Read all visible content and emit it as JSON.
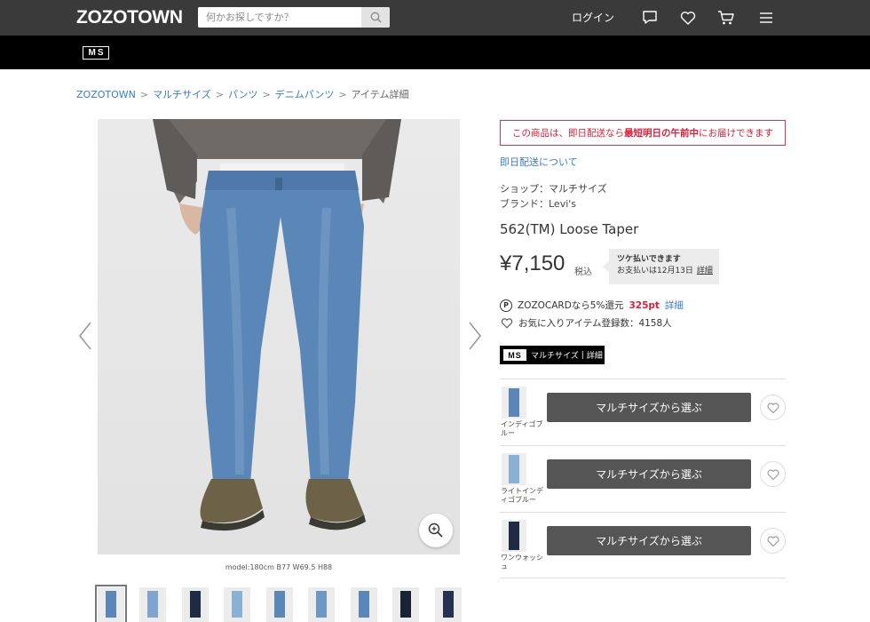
{
  "header": {
    "logo": "ZOZOTOWN",
    "search_placeholder": "何かお探しですか？",
    "login_label": "ログイン",
    "icons": [
      "search-icon",
      "chat-icon",
      "heart-icon",
      "cart-icon",
      "menu-icon"
    ],
    "bg_color": "#3a3a3a"
  },
  "subheader": {
    "shop_logo": "MS",
    "bg_color": "#000000"
  },
  "breadcrumb": {
    "items": [
      "ZOZOTOWN",
      "マルチサイズ",
      "パンツ",
      "デニムパンツ"
    ],
    "current": "アイテム詳細",
    "separator": ">"
  },
  "gallery": {
    "model_info": "model:180cm B77 W69.5 H88",
    "thumbnail_count": 9,
    "selected_thumbnail": 0,
    "icons": [
      "chevron-left-icon",
      "chevron-right-icon",
      "zoom-icon"
    ]
  },
  "product": {
    "delivery_notice": {
      "before": "この商品は、即日配送なら",
      "bold": "最短明日の午前中",
      "after": "にお届けできます"
    },
    "delivery_link": "即日配送について",
    "shop": "ショップ：マルチサイズ",
    "brand": "ブランド：Levi's",
    "name": "562(TM) Loose Taper",
    "price": "¥7,150",
    "tax_label": "税込",
    "tsuke": {
      "line1": "ツケ払いできます",
      "line2": "お支払いは12月13日",
      "link": "詳細"
    },
    "points": {
      "text": "ZOZOCARDなら5%還元",
      "pt": "325pt",
      "link": "詳細"
    },
    "favorites": "お気に入りアイテム登録数：4158人",
    "ms_badge": {
      "box": "MS",
      "label": "マルチサイズ",
      "sep": "|",
      "link": "詳細"
    }
  },
  "variants": [
    {
      "color": "インディゴブルー",
      "button": "マルチサイズから選ぶ"
    },
    {
      "color": "ライトインディゴブルー",
      "button": "マルチサイズから選ぶ"
    },
    {
      "color": "ワンウォッシュ",
      "button": "マルチサイズから選ぶ"
    }
  ],
  "colors": {
    "accent_red": "#d8203a",
    "link_blue": "#3b7cc0",
    "button_gray": "#555555"
  }
}
